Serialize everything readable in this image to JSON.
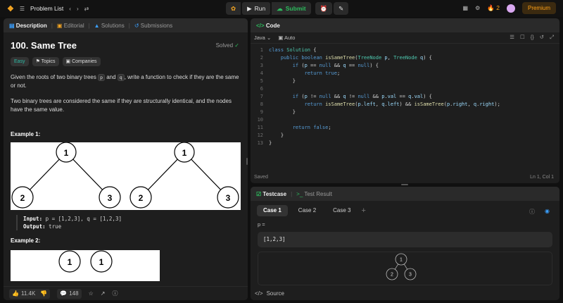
{
  "topbar": {
    "problem_list": "Problem List",
    "run": "Run",
    "submit": "Submit",
    "streak": "2",
    "premium": "Premium"
  },
  "left": {
    "tabs": [
      "Description",
      "Editorial",
      "Solutions",
      "Submissions"
    ],
    "title": "100. Same Tree",
    "solved": "Solved",
    "tags": [
      "Easy",
      "Topics",
      "Companies"
    ],
    "para1_a": "Given the roots of two binary trees ",
    "para1_p": "p",
    "para1_b": " and ",
    "para1_q": "q",
    "para1_c": ", write a function to check if they are the same or not.",
    "para2": "Two binary trees are considered the same if they are structurally identical, and the nodes have the same value.",
    "example1_title": "Example 1:",
    "example1_input_label": "Input:",
    "example1_input": "p = [1,2,3], q = [1,2,3]",
    "example1_output_label": "Output:",
    "example1_output": "true",
    "example2_title": "Example 2:",
    "tree_labels": {
      "root": "1",
      "left": "2",
      "right": "3"
    },
    "footer": {
      "likes": "11.4K",
      "comments": "148"
    }
  },
  "code": {
    "title": "Code",
    "language": "Java",
    "mode": "Auto",
    "status": "Saved",
    "cursor": "Ln 1, Col 1",
    "line_numbers": [
      "1",
      "2",
      "3",
      "4",
      "5",
      "6",
      "7",
      "8",
      "9",
      "10",
      "11",
      "12",
      "13"
    ]
  },
  "test": {
    "tab_testcase": "Testcase",
    "tab_result": "Test Result",
    "cases": [
      "Case 1",
      "Case 2",
      "Case 3"
    ],
    "param_label": "p =",
    "param_value": "[1,2,3]",
    "tree_labels": {
      "root": "1",
      "left": "2",
      "right": "3"
    },
    "source": "Source"
  }
}
